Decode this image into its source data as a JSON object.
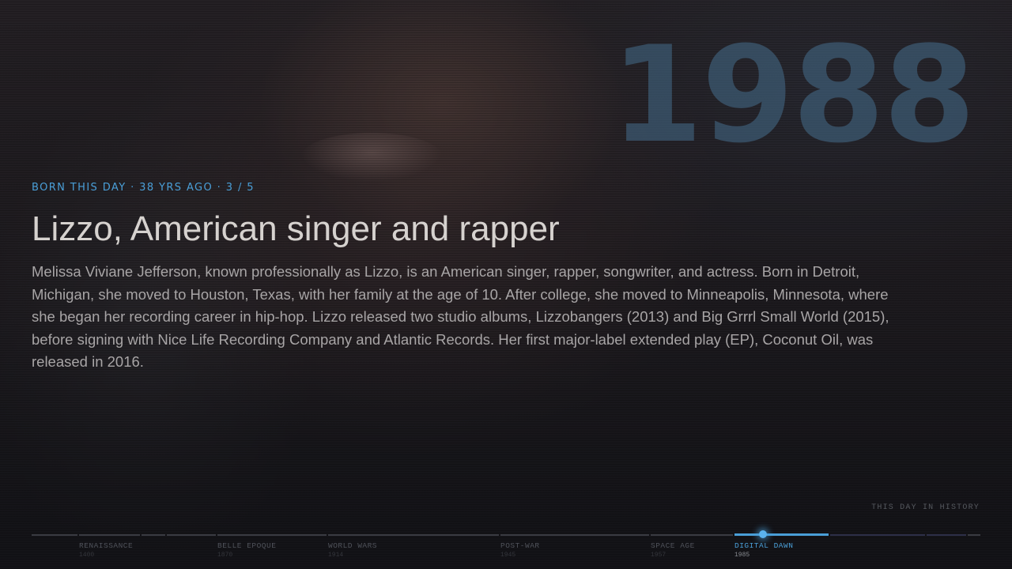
{
  "background": {
    "description_icon": "portrait-photo"
  },
  "hero_year": "1988",
  "kicker": "BORN THIS DAY · 38 YRS AGO · 3 / 5",
  "title": "Lizzo, American singer and rapper",
  "description": "Melissa Viviane Jefferson, known professionally as Lizzo, is an American singer, rapper, songwriter, and actress. Born in Detroit, Michigan, she moved to Houston, Texas, with her family at the age of 10. After college, she moved to Minneapolis, Minnesota, where she began her recording career in hip-hop. Lizzo released two studio albums, Lizzobangers (2013) and Big Grrrl Small World (2015), before signing with Nice Life Recording Company and Atlantic Records. Her first major-label extended play (EP), Coconut Oil, was released in 2016.",
  "brand_label": "THIS DAY IN HISTORY",
  "accent_color": "#4a9fd8",
  "timeline": {
    "eras": [
      {
        "name": "RENAISSANCE",
        "year": "1400"
      },
      {
        "name": "BELLE EPOQUE",
        "year": "1870"
      },
      {
        "name": "WORLD WARS",
        "year": "1914"
      },
      {
        "name": "POST-WAR",
        "year": "1945"
      },
      {
        "name": "SPACE AGE",
        "year": "1957"
      },
      {
        "name": "DIGITAL DAWN",
        "year": "1985"
      }
    ],
    "current_era": "DIGITAL DAWN"
  }
}
